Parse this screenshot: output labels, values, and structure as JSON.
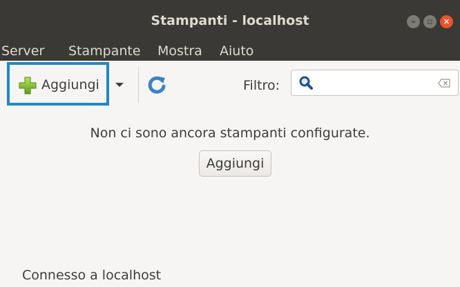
{
  "window": {
    "title": "Stampanti - localhost",
    "controls": {
      "minimize_glyph": "–",
      "maximize_glyph": "▫",
      "close_glyph": "×"
    }
  },
  "menubar": {
    "items": [
      {
        "label": "Server"
      },
      {
        "label": "Stampante"
      },
      {
        "label": "Mostra"
      },
      {
        "label": "Aiuto"
      }
    ]
  },
  "toolbar": {
    "add_label": "Aggiungi",
    "add_icon": "plus-icon",
    "refresh_icon": "refresh-icon",
    "filter_label": "Filtro:",
    "search": {
      "value": "",
      "placeholder": ""
    }
  },
  "content": {
    "empty_message": "Non ci sono ancora stampanti configurate.",
    "add_button_label": "Aggiungi"
  },
  "status": {
    "text": "Connesso a localhost"
  },
  "colors": {
    "titlebar": "#3a3935",
    "highlight_border": "#1e88c7",
    "close_button": "#e9542c",
    "background": "#f6f5f4"
  }
}
